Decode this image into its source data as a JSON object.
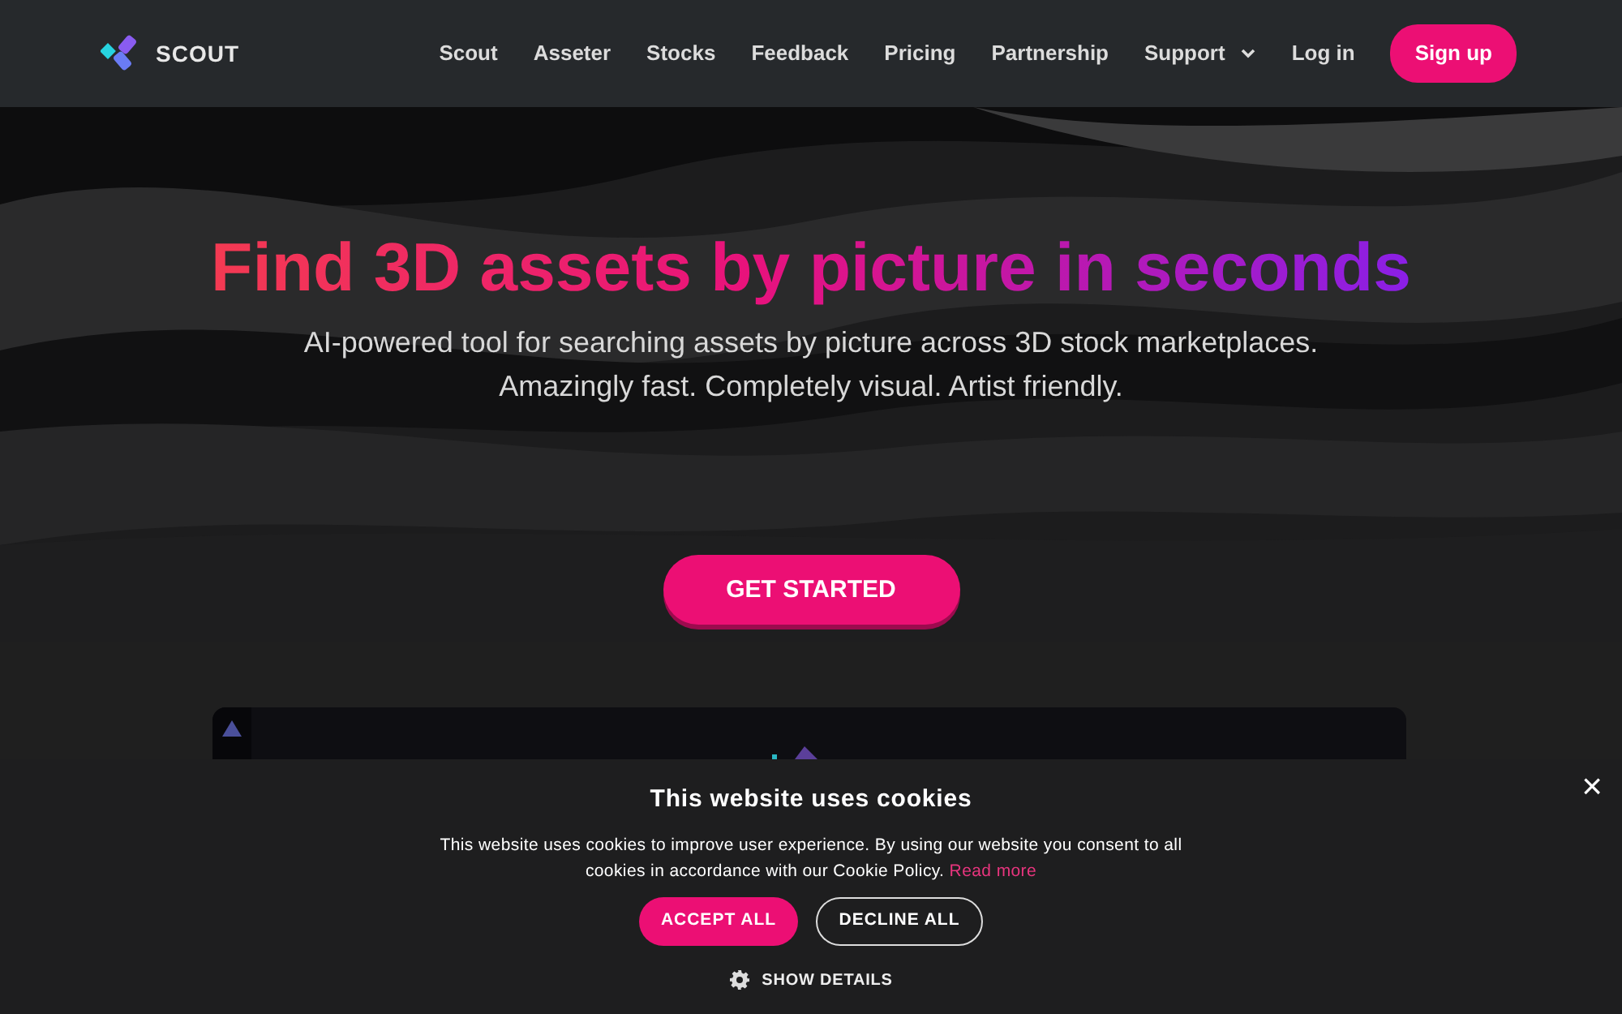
{
  "brand": {
    "name": "SCOUT"
  },
  "nav": {
    "items": [
      {
        "label": "Scout",
        "dropdown": false
      },
      {
        "label": "Asseter",
        "dropdown": false
      },
      {
        "label": "Stocks",
        "dropdown": false
      },
      {
        "label": "Feedback",
        "dropdown": false
      },
      {
        "label": "Pricing",
        "dropdown": false
      },
      {
        "label": "Partnership",
        "dropdown": false
      },
      {
        "label": "Support",
        "dropdown": true
      },
      {
        "label": "Log in",
        "dropdown": false
      }
    ],
    "signup": "Sign up"
  },
  "hero": {
    "title": "Find 3D assets by picture in seconds",
    "subtitle_lines": [
      "AI-powered tool for searching assets by picture across 3D stock marketplaces.",
      "Amazingly fast. Completely visual. Artist friendly."
    ],
    "cta": "GET STARTED"
  },
  "cookie_banner": {
    "title": "This website uses cookies",
    "text": "This website uses cookies to improve user experience. By using our website you consent to all cookies in accordance with our Cookie Policy.",
    "link": "Read more",
    "accept": "ACCEPT ALL",
    "decline": "DECLINE ALL",
    "details": "SHOW DETAILS",
    "close": "×"
  }
}
